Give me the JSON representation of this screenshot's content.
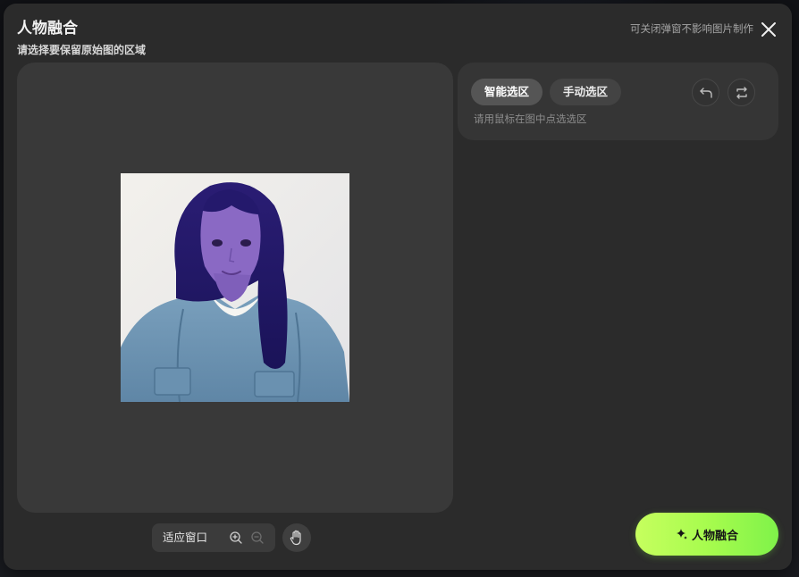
{
  "dialog": {
    "title": "人物融合",
    "subtitle": "请选择要保留原始图的区域",
    "close_hint": "可关闭弹窗不影响图片制作"
  },
  "icons": {
    "close": "close-icon",
    "zoom_in": "zoom-in-icon",
    "zoom_out": "zoom-out-icon",
    "hand": "hand-icon",
    "undo": "undo-icon",
    "reset": "swap-icon",
    "sparkle": "sparkle-icon"
  },
  "toolbar": {
    "fit_label": "适应窗口"
  },
  "selection_panel": {
    "tabs": [
      {
        "label": "智能选区",
        "active": true
      },
      {
        "label": "手动选区",
        "active": false
      }
    ],
    "hint": "请用鼠标在图中点选选区"
  },
  "action": {
    "label": "人物融合"
  },
  "colors": {
    "accent_start": "#c6ff5e",
    "accent_end": "#7ff24a",
    "selection_overlay": "#3a1fa0"
  }
}
